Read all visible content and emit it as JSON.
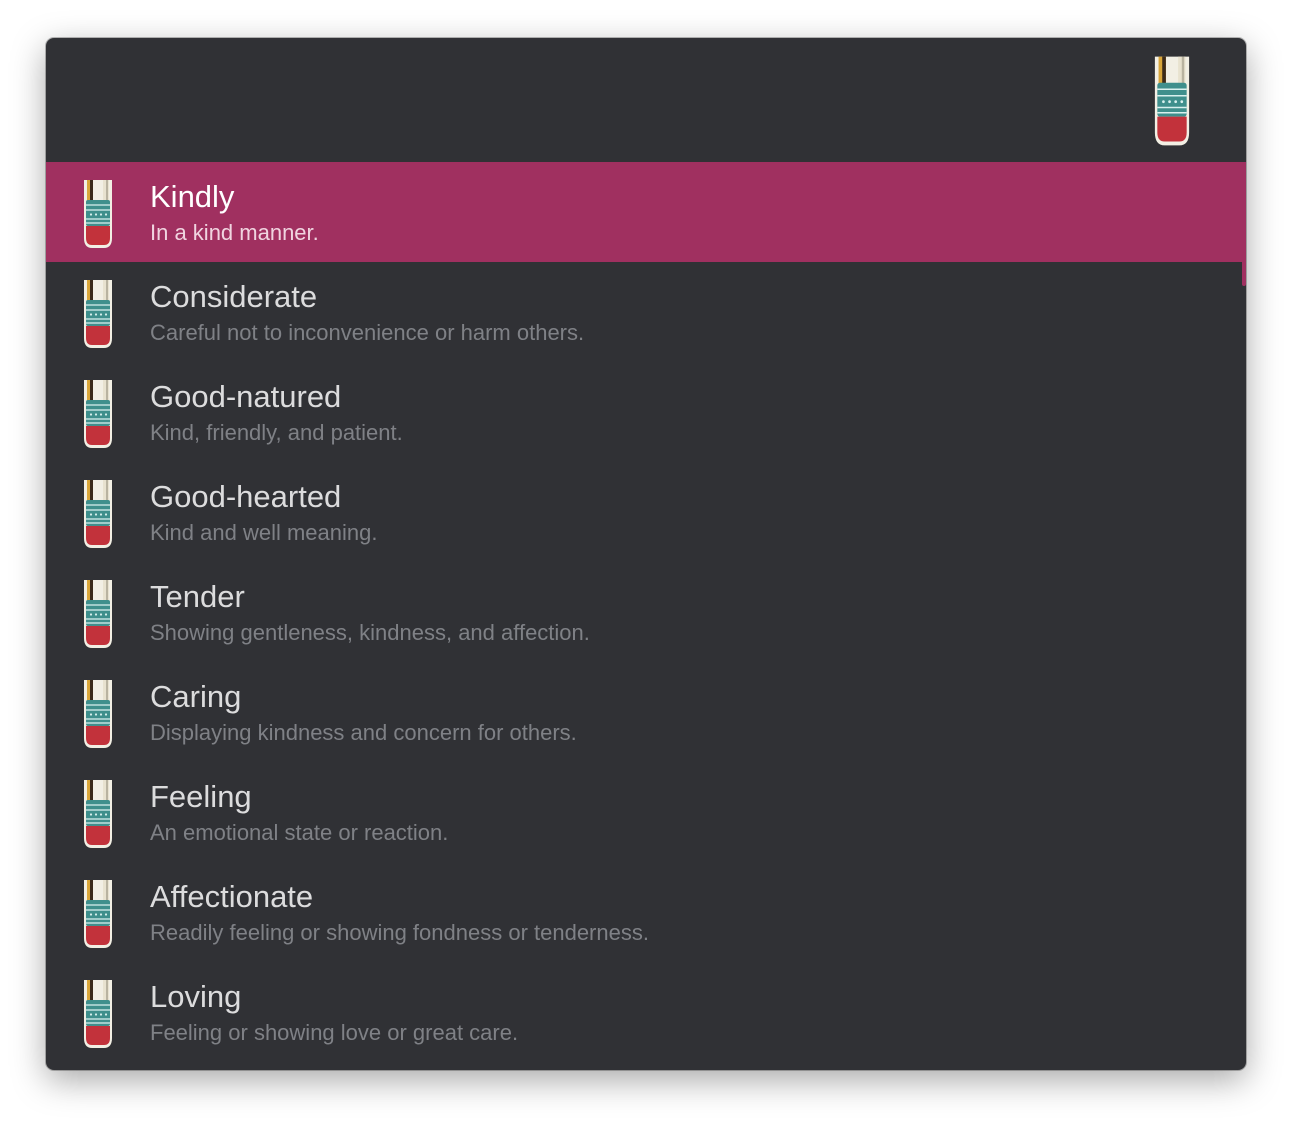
{
  "search": {
    "value": "",
    "placeholder": ""
  },
  "app": {
    "icon": "thesaurus-pencil-icon"
  },
  "colors": {
    "background": "#303135",
    "selected": "#a03060",
    "title": "#dcdcdd",
    "subtitle": "#7f8186"
  },
  "results": [
    {
      "title": "Kindly",
      "subtitle": "In a kind manner.",
      "selected": true
    },
    {
      "title": "Considerate",
      "subtitle": "Careful not to inconvenience or harm others."
    },
    {
      "title": "Good-natured",
      "subtitle": "Kind, friendly, and patient."
    },
    {
      "title": "Good-hearted",
      "subtitle": "Kind and well meaning."
    },
    {
      "title": "Tender",
      "subtitle": "Showing gentleness, kindness, and affection."
    },
    {
      "title": "Caring",
      "subtitle": "Displaying kindness and concern for others."
    },
    {
      "title": "Feeling",
      "subtitle": "An emotional state or reaction."
    },
    {
      "title": "Affectionate",
      "subtitle": "Readily feeling or showing fondness or tenderness."
    },
    {
      "title": "Loving",
      "subtitle": "Feeling or showing love or great care."
    }
  ]
}
